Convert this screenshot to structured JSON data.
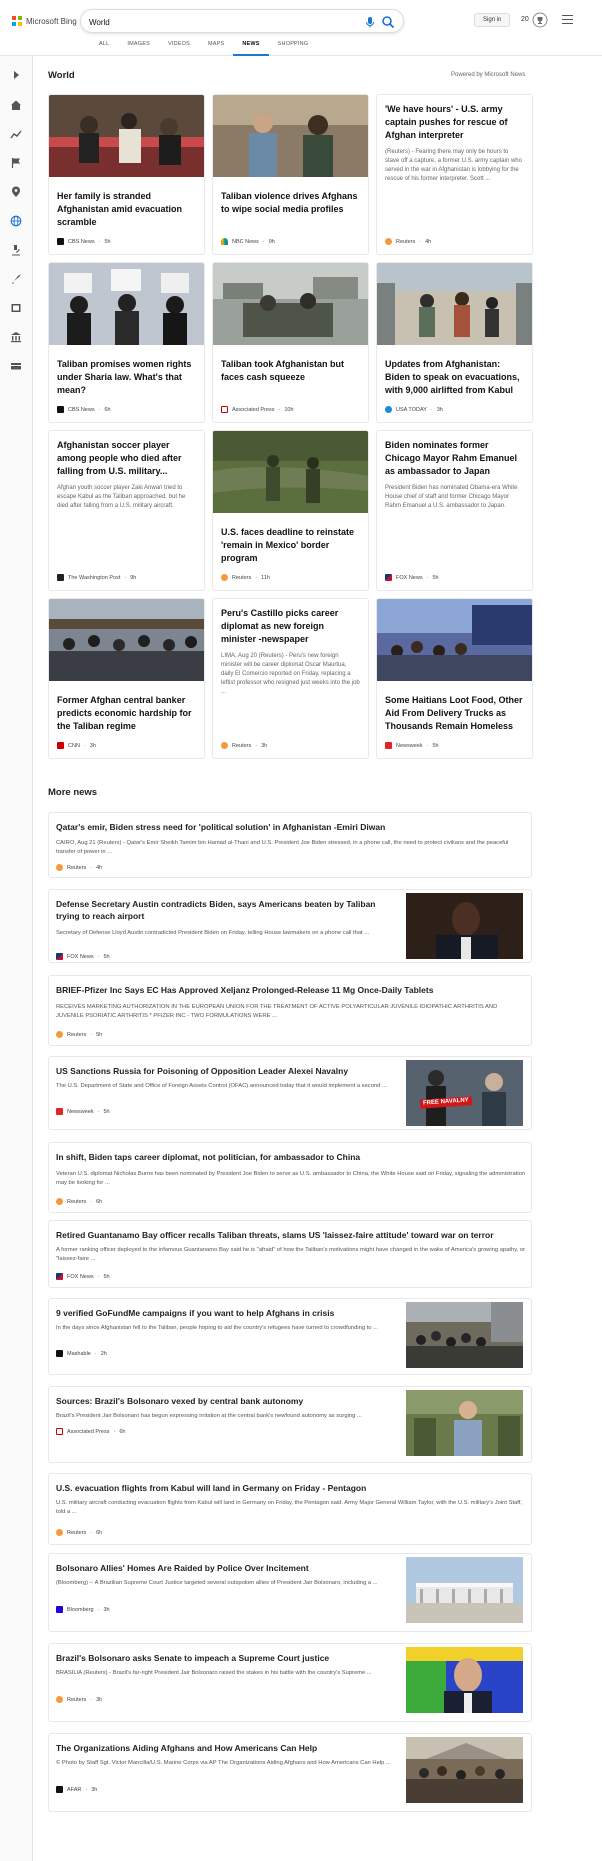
{
  "header": {
    "logo_text": "Microsoft Bing",
    "search_value": "World",
    "signin_label": "Sign in",
    "rewards_count": "20"
  },
  "tabs": [
    "ALL",
    "IMAGES",
    "VIDEOS",
    "MAPS",
    "NEWS",
    "SHOPPING"
  ],
  "active_tab": "NEWS",
  "section": {
    "title": "World",
    "powered_by": "Powered by Microsoft News"
  },
  "cards": [
    {
      "title": "Her family is stranded Afghanistan amid evacuation scramble",
      "snippet": "",
      "source": "CBS News",
      "time": "5h"
    },
    {
      "title": "Taliban violence drives Afghans to wipe social media profiles",
      "snippet": "",
      "source": "NBC News",
      "time": "9h"
    },
    {
      "title": "'We have hours' - U.S. army captain pushes for rescue of Afghan interpreter",
      "snippet": "(Reuters) - Fearing there may only be hours to stave off a capture, a former U.S. army captain who served in the war in Afghanistan is lobbying for the rescue of his former interpreter.      Scott ...",
      "source": "Reuters",
      "time": "4h"
    },
    {
      "title": "Taliban promises women rights under Sharia law. What's that mean?",
      "snippet": "",
      "source": "CBS News",
      "time": "6h"
    },
    {
      "title": "Taliban took Afghanistan but faces cash squeeze",
      "snippet": "",
      "source": "Associated Press",
      "time": "10h"
    },
    {
      "title": "Updates from Afghanistan: Biden to speak on evacuations, with 9,000 airlifted from Kabul",
      "snippet": "",
      "source": "USA TODAY",
      "time": "3h"
    },
    {
      "title": "Afghanistan soccer player among people who died after falling from U.S. military...",
      "snippet": "Afghan youth soccer player Zaki Anwari tried to escape Kabul as the Taliban approached, but he died after falling from a U.S. military aircraft.",
      "source": "The Washington Post",
      "time": "9h"
    },
    {
      "title": "U.S. faces deadline to reinstate 'remain in Mexico' border program",
      "snippet": "",
      "source": "Reuters",
      "time": "11h"
    },
    {
      "title": "Biden nominates former Chicago Mayor Rahm Emanuel as ambassador to Japan",
      "snippet": "President Biden has nominated Obama-era White House chief of staff and former Chicago Mayor Rahm Emanuel a U.S. ambassador to Japan.",
      "source": "FOX News",
      "time": "5h"
    },
    {
      "title": "Former Afghan central banker predicts economic hardship for the Taliban regime",
      "snippet": "",
      "source": "CNN",
      "time": "3h"
    },
    {
      "title": "Peru's Castillo picks career diplomat as new foreign minister -newspaper",
      "snippet": "LIMA, Aug 20 (Reuters) - Peru's new foreign minister will be career diplomat Oscar Maurtua, daily El Comercio reported on Friday, replacing a leftist professor who resigned just weeks into the job ...",
      "source": "Reuters",
      "time": "3h"
    },
    {
      "title": "Some Haitians Loot Food, Other Aid From Delivery Trucks as Thousands Remain Homeless",
      "snippet": "",
      "source": "Newsweek",
      "time": "5h"
    }
  ],
  "more_news_title": "More news",
  "more_news": [
    {
      "title": "Qatar's emir, Biden stress need for 'political solution' in Afghanistan -Emiri Diwan",
      "snippet": "CAIRO, Aug 21 (Reuters) - Qatar's Emir Sheikh Tamim bin Hamad al-Thani and U.S. President Joe Biden stressed, in a phone call, the need to protect civilians and the peaceful transfer of power in ...",
      "source": "Reuters",
      "time": "4h"
    },
    {
      "title": "Defense Secretary Austin contradicts Biden, says Americans beaten by Taliban trying to reach airport",
      "snippet": "Secretary of Defense Lloyd Austin contradicted President Biden on Friday, telling House lawmakers on a phone call that ...",
      "source": "FOX News",
      "time": "5h"
    },
    {
      "title": "BRIEF-Pfizer Inc Says EC Has Approved Xeljanz Prolonged-Release 11 Mg Once-Daily Tablets",
      "snippet": "RECEIVES MARKETING AUTHORIZATION IN THE EUROPEAN UNION FOR THE TREATMENT OF ACTIVE POLYARTICULAR JUVENILE IDIOPATHIC ARTHRITIS AND JUVENILE PSORIATIC ARTHRITIS * PFIZER INC - TWO FORMULATIONS WERE ...",
      "source": "Reuters",
      "time": "5h"
    },
    {
      "title": "US Sanctions Russia for Poisoning of Opposition Leader Alexei Navalny",
      "snippet": "The U.S. Department of State and Office of Foreign Assets Control (OFAC) announced today that it would implement a second ...",
      "source": "Newsweek",
      "time": "5h",
      "image_text": "FREE NAVALNY"
    },
    {
      "title": "In shift, Biden taps career diplomat, not politician, for ambassador to China",
      "snippet": "Veteran U.S. diplomat Nicholas Burns has been nominated by President Joe Biden to serve as U.S. ambassador to China, the White House said on Friday, signaling the administration may be looking for ...",
      "source": "Reuters",
      "time": "6h"
    },
    {
      "title": "Retired Guantanamo Bay officer recalls Taliban threats, slams US 'laissez-faire attitude' toward war on terror",
      "snippet": "A former ranking officer deployed to the infamous Guantanamo Bay said he is \"afraid\" of how the Taliban's motivations might have changed in the wake of America's growing apathy, or \"laissez-faire ...",
      "source": "FOX News",
      "time": "5h"
    },
    {
      "title": "9 verified GoFundMe campaigns if you want to help Afghans in crisis",
      "snippet": "In the days since Afghanistan fell to the Taliban, people hoping to aid the country's refugees have turned to crowdfunding to ...",
      "source": "Mashable",
      "time": "2h"
    },
    {
      "title": "Sources: Brazil's Bolsonaro vexed by central bank autonomy",
      "snippet": "Brazil's President Jair Bolsonaro has begun expressing irritation at the central bank's newfound autonomy as surging ...",
      "source": "Associated Press",
      "time": "6h"
    },
    {
      "title": "U.S. evacuation flights from Kabul will land in Germany on Friday - Pentagon",
      "snippet": "U.S. military aircraft conducting evacuation flights from Kabul will land in Germany on Friday, the Pentagon said. Army Major General William Taylor, with the U.S. military's Joint Staff, told a ...",
      "source": "Reuters",
      "time": "6h"
    },
    {
      "title": "Bolsonaro Allies' Homes Are Raided by Police Over Incitement",
      "snippet": "(Bloomberg) -- A Brazilian Supreme Court Justice targeted several outspoken allies of President Jair Bolsonaro, including a ...",
      "source": "Bloomberg",
      "time": "3h"
    },
    {
      "title": "Brazil's Bolsonaro asks Senate to impeach a Supreme Court justice",
      "snippet": "BRASILIA (Reuters) - Brazil's far-right President Jair Bolsonaro raised the stakes in his battle with the country's Supreme ...",
      "source": "Reuters",
      "time": "3h"
    },
    {
      "title": "The Organizations Aiding Afghans and How Americans Can Help",
      "snippet": "© Photo by Staff Sgt. Victor Mancilla/U.S. Marine Corps via AP The Organizations Aiding Afghans and How Americans Can Help ...",
      "source": "AFAR",
      "time": "3h"
    }
  ]
}
